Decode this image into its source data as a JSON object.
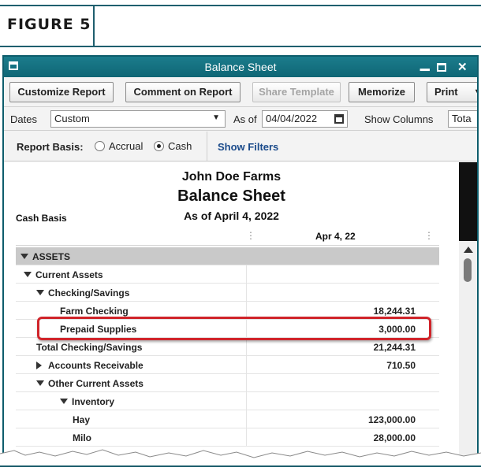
{
  "figure": {
    "label": "FIGURE 5"
  },
  "window": {
    "title": "Balance Sheet",
    "minimize": "▁",
    "close": "✕"
  },
  "toolbar": {
    "customize": "Customize Report",
    "comment": "Comment on Report",
    "share": "Share Template",
    "memorize": "Memorize",
    "print": "Print",
    "print_caret": "▾"
  },
  "dates": {
    "label": "Dates",
    "range": "Custom",
    "as_of_label": "As of",
    "as_of_value": "04/04/2022",
    "show_columns_label": "Show Columns",
    "show_columns_value": "Tota"
  },
  "basis": {
    "label": "Report Basis:",
    "accrual": "Accrual",
    "cash": "Cash",
    "selected": "Cash",
    "show_filters": "Show Filters"
  },
  "report": {
    "company": "John Doe Farms",
    "title": "Balance Sheet",
    "subtitle": "As of April 4, 2022",
    "basis_note": "Cash Basis",
    "column": "Apr 4, 22",
    "rows": [
      {
        "label": "ASSETS",
        "value": "",
        "indent": 0,
        "toggle": "down"
      },
      {
        "label": "Current Assets",
        "value": "",
        "indent": 1,
        "toggle": "down"
      },
      {
        "label": "Checking/Savings",
        "value": "",
        "indent": 2,
        "toggle": "down"
      },
      {
        "label": "Farm Checking",
        "value": "18,244.31",
        "indent": 3,
        "toggle": ""
      },
      {
        "label": "Prepaid Supplies",
        "value": "3,000.00",
        "indent": 3,
        "toggle": ""
      },
      {
        "label": "Total Checking/Savings",
        "value": "21,244.31",
        "indent": 2,
        "toggle": ""
      },
      {
        "label": "Accounts Receivable",
        "value": "710.50",
        "indent": 2,
        "toggle": "right"
      },
      {
        "label": "Other Current Assets",
        "value": "",
        "indent": 2,
        "toggle": "down"
      },
      {
        "label": "Inventory",
        "value": "",
        "indent": 3,
        "toggle": "down"
      },
      {
        "label": "Hay",
        "value": "123,000.00",
        "indent": 4,
        "toggle": ""
      },
      {
        "label": "Milo",
        "value": "28,000.00",
        "indent": 4,
        "toggle": ""
      }
    ]
  },
  "colors": {
    "accent": "#0f6675",
    "highlight": "#d0242a",
    "link": "#1a4a8a"
  }
}
